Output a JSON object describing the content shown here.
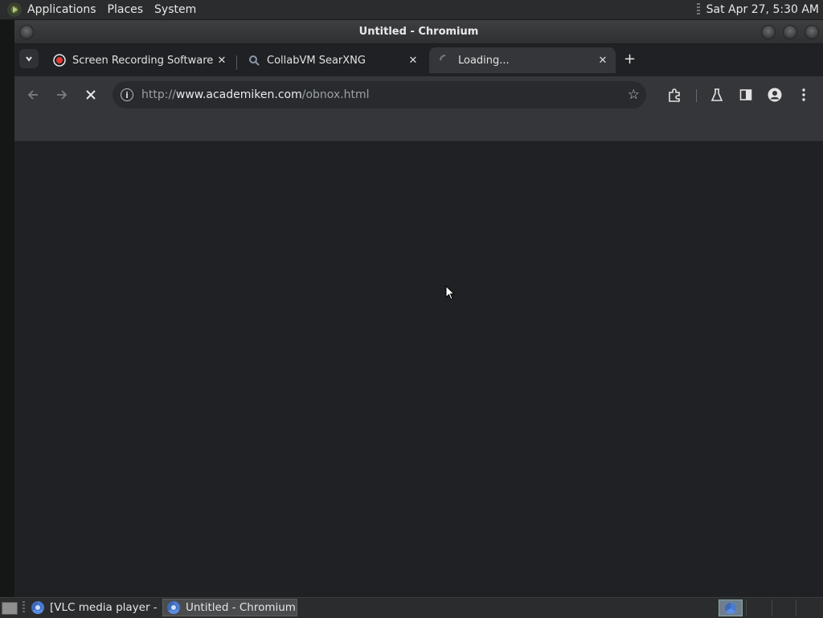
{
  "top_panel": {
    "menus": [
      "Applications",
      "Places",
      "System"
    ],
    "clock": "Sat Apr 27,  5:30 AM"
  },
  "window": {
    "title": "Untitled - Chromium"
  },
  "tabs": [
    {
      "label": "Screen Recording Software: c",
      "icon": "record-icon",
      "close": "✕",
      "active": false
    },
    {
      "label": "CollabVM SearXNG",
      "icon": "searxng-icon",
      "close": "✕",
      "active": false
    },
    {
      "label": "Loading...",
      "icon": "loading-spinner-icon",
      "close": "✕",
      "active": true
    }
  ],
  "new_tab_label": "+",
  "omnibox": {
    "scheme": "http://",
    "host": "www.academiken.com",
    "path": "/obnox.html"
  },
  "taskbar": {
    "tasks": [
      {
        "label": "[VLC media player - ...",
        "active": false
      },
      {
        "label": "Untitled - Chromium",
        "active": true
      }
    ]
  },
  "colors": {
    "page_background": "#202124",
    "toolbar": "#35363a",
    "panel": "#2b2c2d",
    "record_red": "#e53935"
  }
}
